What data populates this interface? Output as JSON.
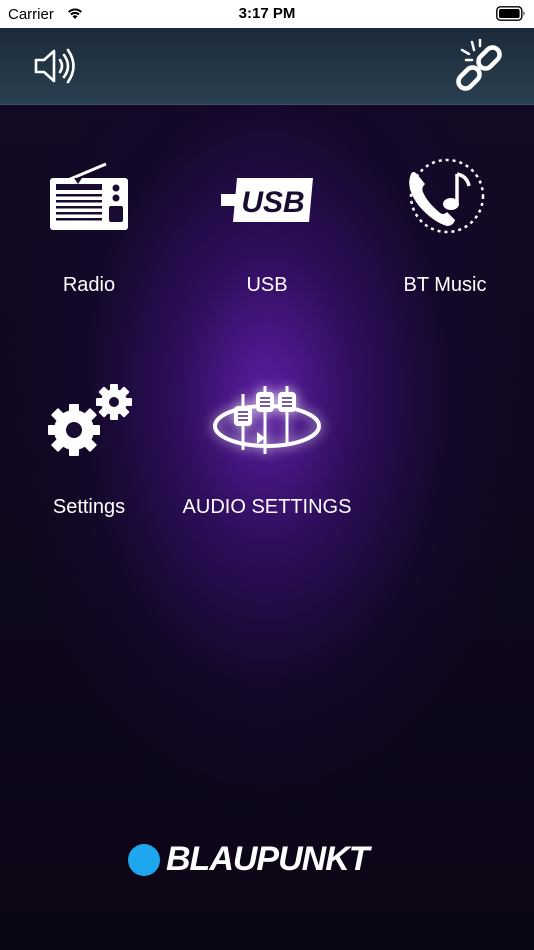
{
  "status_bar": {
    "carrier": "Carrier",
    "time": "3:17 PM"
  },
  "header": {
    "left_icon": "speaker-icon",
    "right_icon": "link-icon"
  },
  "tiles": [
    {
      "label": "Radio",
      "icon": "radio-icon"
    },
    {
      "label": "USB",
      "icon": "usb-icon"
    },
    {
      "label": "BT Music",
      "icon": "bt-music-icon"
    },
    {
      "label": "Settings",
      "icon": "gears-icon"
    },
    {
      "label": "AUDIO SETTINGS",
      "icon": "equalizer-icon"
    }
  ],
  "brand": {
    "name": "BLAUPUNKT",
    "dot_color": "#1ea7ef"
  },
  "colors": {
    "background": "#0c0718",
    "glow": "#5f1eaa",
    "header": "#233645"
  }
}
